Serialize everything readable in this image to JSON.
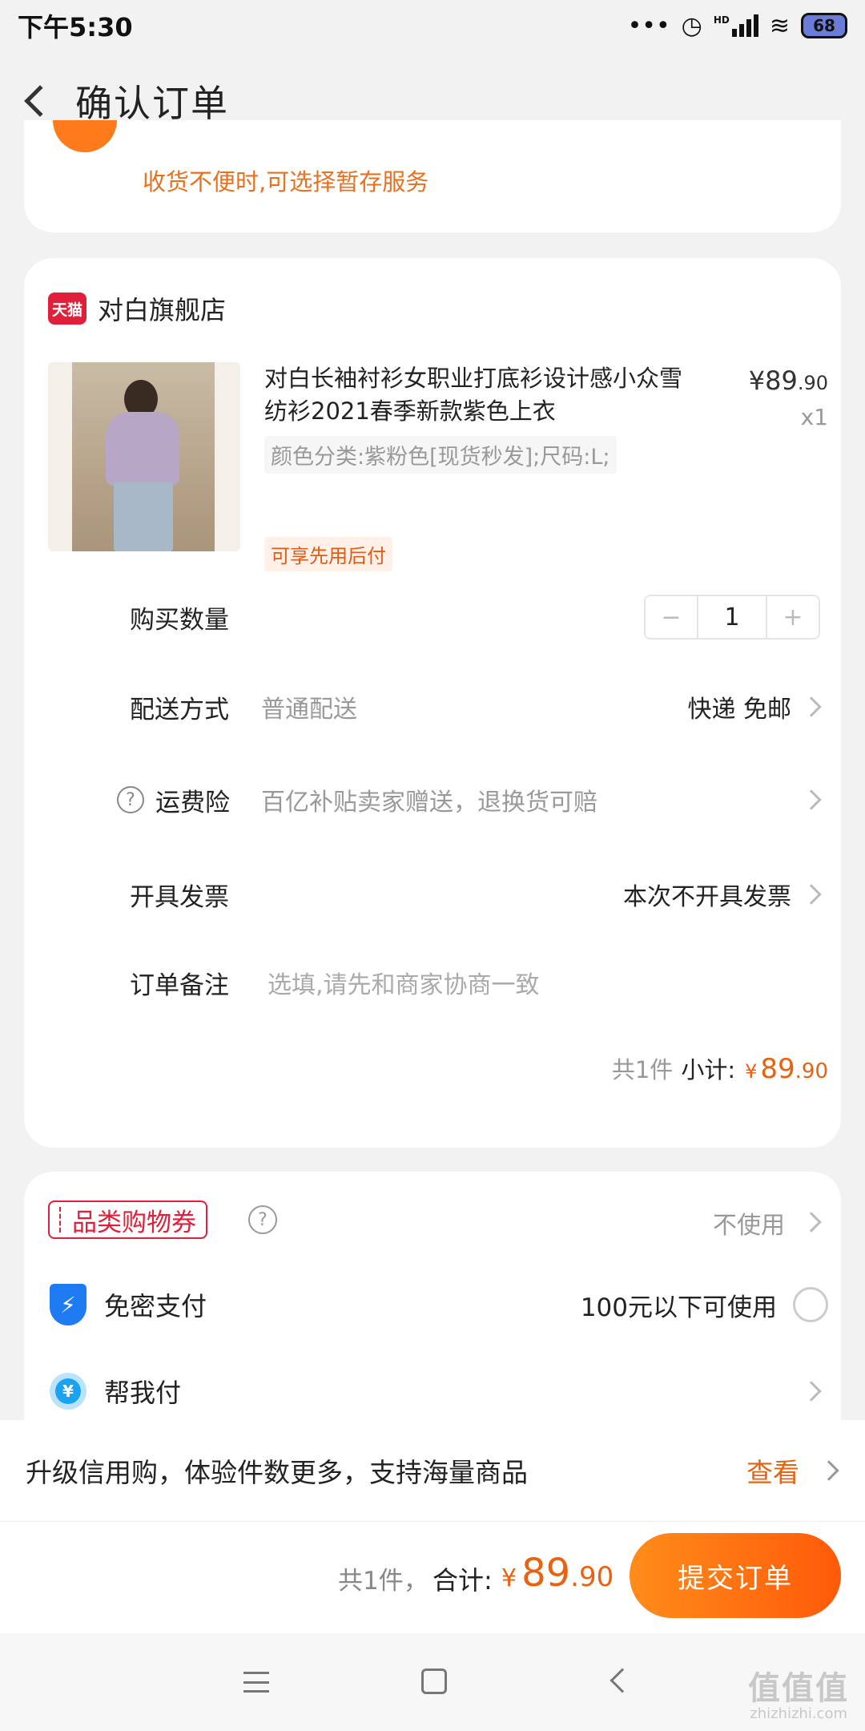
{
  "status_bar": {
    "time": "下午5:30",
    "dots": "•••",
    "hd": "HD",
    "battery": "68",
    "icons": [
      "alarm-icon",
      "signal-icon",
      "wifi-icon",
      "battery-icon"
    ]
  },
  "header": {
    "title": "确认订单"
  },
  "address": {
    "notice": "收货不便时,可选择暂存服务"
  },
  "order": {
    "tmall_logo": "天猫",
    "shop_name": "对白旗舰店",
    "product": {
      "title": "对白长袖衬衫女职业打底衫设计感小众雪纺衫2021春季新款紫色上衣",
      "price_symbol": "¥",
      "price_int": "89",
      "price_dec": ".90",
      "qty": "x1",
      "sku": "颜色分类:紫粉色[现货秒发];尺码:L;",
      "pay_later": "可享先用后付"
    },
    "quantity": {
      "label": "购买数量",
      "minus": "−",
      "value": "1",
      "plus": "+"
    },
    "delivery": {
      "label": "配送方式",
      "hint": "普通配送",
      "value": "快递 免邮"
    },
    "insurance": {
      "label": "运费险",
      "hint": "百亿补贴卖家赠送，退换货可赔",
      "q": "?"
    },
    "invoice": {
      "label": "开具发票",
      "value": "本次不开具发票"
    },
    "note": {
      "label": "订单备注",
      "placeholder": "选填,请先和商家协商一致"
    },
    "subtotal": {
      "count": "共1件",
      "label": "小计:",
      "yen": "¥",
      "int": "89",
      "dec": ".90"
    }
  },
  "payment": {
    "coupon": {
      "label": "品类购物券",
      "q": "?",
      "value": "不使用"
    },
    "password_free": {
      "label": "免密支付",
      "value": "100元以下可使用",
      "icon_glyph": "⚡"
    },
    "help_pay": {
      "label": "帮我付",
      "icon_glyph": "¥"
    }
  },
  "credit_banner": {
    "text": "升级信用购，体验件数更多，支持海量商品",
    "action": "查看"
  },
  "bottom_bar": {
    "count": "共1件，",
    "label": "合计:",
    "yen": "¥",
    "int": "89",
    "dec": ".90",
    "submit": "提交订单"
  },
  "watermark": {
    "text": "值值值",
    "url": "zhizhizhi.com"
  },
  "colors": {
    "accent_orange": "#e8620f",
    "tmall_red": "#e0203a",
    "alipay_blue": "#1e7bf2"
  }
}
